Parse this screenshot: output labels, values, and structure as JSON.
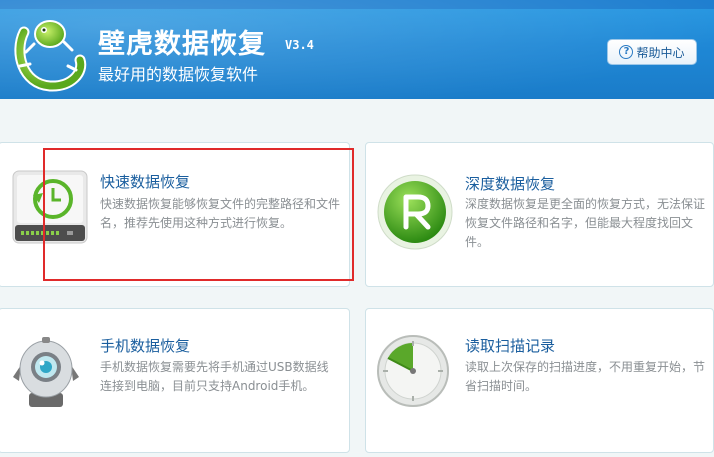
{
  "header": {
    "title": "壁虎数据恢复",
    "version": "V3.4",
    "subtitle": "最好用的数据恢复软件",
    "help_label": "帮助中心"
  },
  "options": [
    {
      "title": "快速数据恢复",
      "desc": "快速数据恢复能够恢复文件的完整路径和文件名，推荐先使用这种方式进行恢复。",
      "icon": "hard-drive-clock-icon"
    },
    {
      "title": "深度数据恢复",
      "desc": "深度数据恢复是更全面的恢复方式，无法保证恢复文件路径和名字，但能最大程度找回文件。",
      "icon": "green-r-icon"
    },
    {
      "title": "手机数据恢复",
      "desc": "手机数据恢复需要先将手机通过USB数据线连接到电脑，目前只支持Android手机。",
      "icon": "robot-phone-icon"
    },
    {
      "title": "读取扫描记录",
      "desc": "读取上次保存的扫描进度，不用重复开始，节省扫描时间。",
      "icon": "radar-scan-icon"
    }
  ],
  "colors": {
    "header_blue": "#1f88d6",
    "title_blue": "#1a5e9e",
    "highlight_red": "#e02a2a"
  }
}
